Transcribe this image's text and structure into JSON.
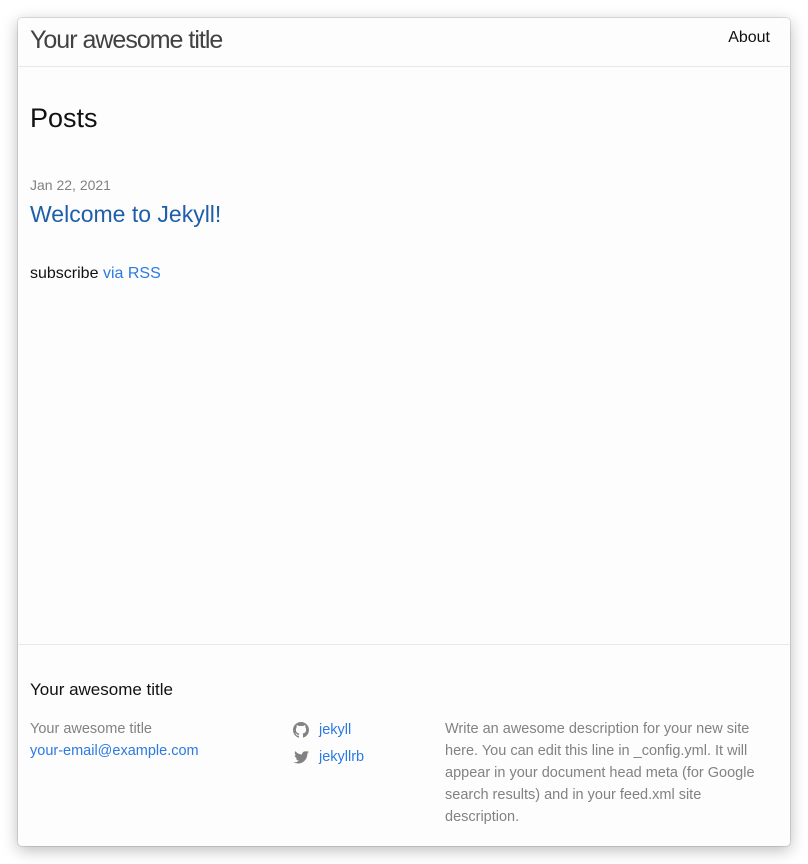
{
  "header": {
    "site_title": "Your awesome title",
    "nav": [
      {
        "label": "About"
      }
    ]
  },
  "main": {
    "heading": "Posts",
    "posts": [
      {
        "date": "Jan 22, 2021",
        "title": "Welcome to Jekyll!"
      }
    ],
    "rss": {
      "prefix": "subscribe",
      "link_label": "via RSS"
    }
  },
  "footer": {
    "heading": "Your awesome title",
    "contact": {
      "name": "Your awesome title",
      "email": "your-email@example.com"
    },
    "social": [
      {
        "icon": "github-icon",
        "label": "jekyll"
      },
      {
        "icon": "twitter-icon",
        "label": "jekyllrb"
      }
    ],
    "description": "Write an awesome description for your new site here. You can edit this line in _config.yml. It will appear in your document head meta (for Google search results) and in your feed.xml site description."
  },
  "colors": {
    "link": "#2a7ae2",
    "text": "#111111",
    "muted": "#828282",
    "border": "#e8e8e8"
  }
}
